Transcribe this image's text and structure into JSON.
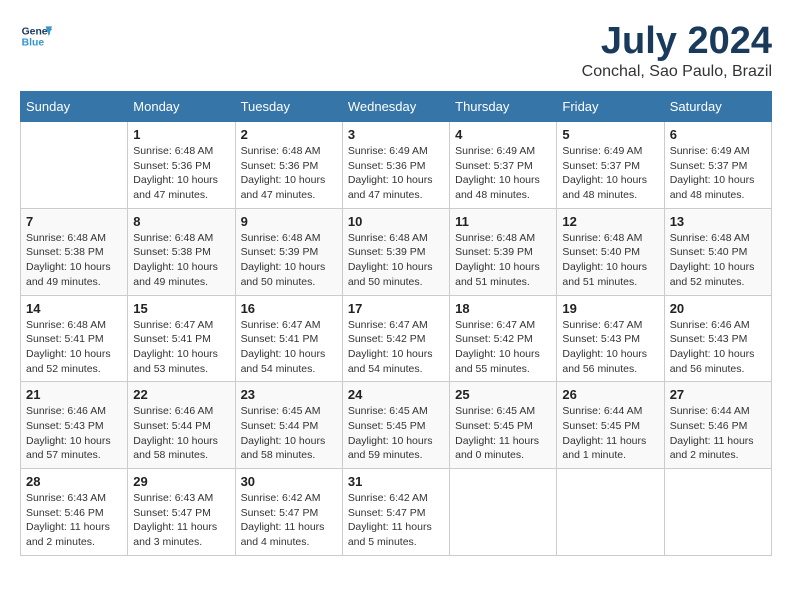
{
  "logo": {
    "line1": "General",
    "line2": "Blue"
  },
  "title": "July 2024",
  "subtitle": "Conchal, Sao Paulo, Brazil",
  "weekdays": [
    "Sunday",
    "Monday",
    "Tuesday",
    "Wednesday",
    "Thursday",
    "Friday",
    "Saturday"
  ],
  "weeks": [
    [
      {
        "day": "",
        "detail": ""
      },
      {
        "day": "1",
        "detail": "Sunrise: 6:48 AM\nSunset: 5:36 PM\nDaylight: 10 hours\nand 47 minutes."
      },
      {
        "day": "2",
        "detail": "Sunrise: 6:48 AM\nSunset: 5:36 PM\nDaylight: 10 hours\nand 47 minutes."
      },
      {
        "day": "3",
        "detail": "Sunrise: 6:49 AM\nSunset: 5:36 PM\nDaylight: 10 hours\nand 47 minutes."
      },
      {
        "day": "4",
        "detail": "Sunrise: 6:49 AM\nSunset: 5:37 PM\nDaylight: 10 hours\nand 48 minutes."
      },
      {
        "day": "5",
        "detail": "Sunrise: 6:49 AM\nSunset: 5:37 PM\nDaylight: 10 hours\nand 48 minutes."
      },
      {
        "day": "6",
        "detail": "Sunrise: 6:49 AM\nSunset: 5:37 PM\nDaylight: 10 hours\nand 48 minutes."
      }
    ],
    [
      {
        "day": "7",
        "detail": "Sunrise: 6:48 AM\nSunset: 5:38 PM\nDaylight: 10 hours\nand 49 minutes."
      },
      {
        "day": "8",
        "detail": "Sunrise: 6:48 AM\nSunset: 5:38 PM\nDaylight: 10 hours\nand 49 minutes."
      },
      {
        "day": "9",
        "detail": "Sunrise: 6:48 AM\nSunset: 5:39 PM\nDaylight: 10 hours\nand 50 minutes."
      },
      {
        "day": "10",
        "detail": "Sunrise: 6:48 AM\nSunset: 5:39 PM\nDaylight: 10 hours\nand 50 minutes."
      },
      {
        "day": "11",
        "detail": "Sunrise: 6:48 AM\nSunset: 5:39 PM\nDaylight: 10 hours\nand 51 minutes."
      },
      {
        "day": "12",
        "detail": "Sunrise: 6:48 AM\nSunset: 5:40 PM\nDaylight: 10 hours\nand 51 minutes."
      },
      {
        "day": "13",
        "detail": "Sunrise: 6:48 AM\nSunset: 5:40 PM\nDaylight: 10 hours\nand 52 minutes."
      }
    ],
    [
      {
        "day": "14",
        "detail": "Sunrise: 6:48 AM\nSunset: 5:41 PM\nDaylight: 10 hours\nand 52 minutes."
      },
      {
        "day": "15",
        "detail": "Sunrise: 6:47 AM\nSunset: 5:41 PM\nDaylight: 10 hours\nand 53 minutes."
      },
      {
        "day": "16",
        "detail": "Sunrise: 6:47 AM\nSunset: 5:41 PM\nDaylight: 10 hours\nand 54 minutes."
      },
      {
        "day": "17",
        "detail": "Sunrise: 6:47 AM\nSunset: 5:42 PM\nDaylight: 10 hours\nand 54 minutes."
      },
      {
        "day": "18",
        "detail": "Sunrise: 6:47 AM\nSunset: 5:42 PM\nDaylight: 10 hours\nand 55 minutes."
      },
      {
        "day": "19",
        "detail": "Sunrise: 6:47 AM\nSunset: 5:43 PM\nDaylight: 10 hours\nand 56 minutes."
      },
      {
        "day": "20",
        "detail": "Sunrise: 6:46 AM\nSunset: 5:43 PM\nDaylight: 10 hours\nand 56 minutes."
      }
    ],
    [
      {
        "day": "21",
        "detail": "Sunrise: 6:46 AM\nSunset: 5:43 PM\nDaylight: 10 hours\nand 57 minutes."
      },
      {
        "day": "22",
        "detail": "Sunrise: 6:46 AM\nSunset: 5:44 PM\nDaylight: 10 hours\nand 58 minutes."
      },
      {
        "day": "23",
        "detail": "Sunrise: 6:45 AM\nSunset: 5:44 PM\nDaylight: 10 hours\nand 58 minutes."
      },
      {
        "day": "24",
        "detail": "Sunrise: 6:45 AM\nSunset: 5:45 PM\nDaylight: 10 hours\nand 59 minutes."
      },
      {
        "day": "25",
        "detail": "Sunrise: 6:45 AM\nSunset: 5:45 PM\nDaylight: 11 hours\nand 0 minutes."
      },
      {
        "day": "26",
        "detail": "Sunrise: 6:44 AM\nSunset: 5:45 PM\nDaylight: 11 hours\nand 1 minute."
      },
      {
        "day": "27",
        "detail": "Sunrise: 6:44 AM\nSunset: 5:46 PM\nDaylight: 11 hours\nand 2 minutes."
      }
    ],
    [
      {
        "day": "28",
        "detail": "Sunrise: 6:43 AM\nSunset: 5:46 PM\nDaylight: 11 hours\nand 2 minutes."
      },
      {
        "day": "29",
        "detail": "Sunrise: 6:43 AM\nSunset: 5:47 PM\nDaylight: 11 hours\nand 3 minutes."
      },
      {
        "day": "30",
        "detail": "Sunrise: 6:42 AM\nSunset: 5:47 PM\nDaylight: 11 hours\nand 4 minutes."
      },
      {
        "day": "31",
        "detail": "Sunrise: 6:42 AM\nSunset: 5:47 PM\nDaylight: 11 hours\nand 5 minutes."
      },
      {
        "day": "",
        "detail": ""
      },
      {
        "day": "",
        "detail": ""
      },
      {
        "day": "",
        "detail": ""
      }
    ]
  ]
}
